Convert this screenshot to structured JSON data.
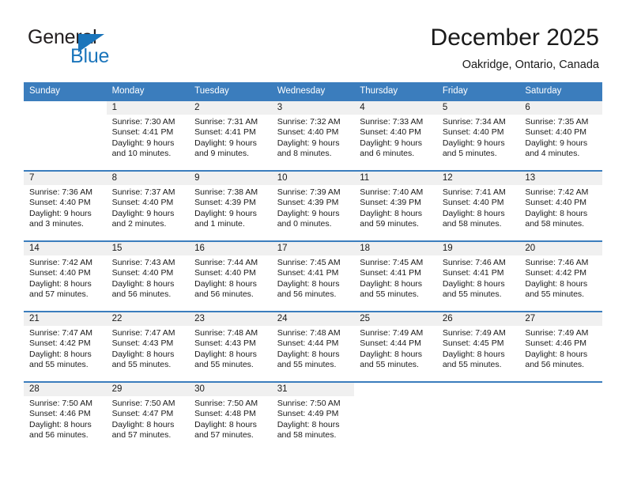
{
  "brand": {
    "name_top": "General",
    "name_bottom": "Blue",
    "color_primary": "#1b75bb",
    "color_text": "#231f20"
  },
  "header": {
    "month_title": "December 2025",
    "location": "Oakridge, Ontario, Canada",
    "header_bg": "#3b7dbd",
    "daynum_bg": "#f0f0f0"
  },
  "calendar": {
    "weekday_headers": [
      "Sunday",
      "Monday",
      "Tuesday",
      "Wednesday",
      "Thursday",
      "Friday",
      "Saturday"
    ],
    "weeks": [
      [
        {
          "empty": true
        },
        {
          "day": "1",
          "sunrise": "Sunrise: 7:30 AM",
          "sunset": "Sunset: 4:41 PM",
          "daylight": "Daylight: 9 hours and 10 minutes."
        },
        {
          "day": "2",
          "sunrise": "Sunrise: 7:31 AM",
          "sunset": "Sunset: 4:41 PM",
          "daylight": "Daylight: 9 hours and 9 minutes."
        },
        {
          "day": "3",
          "sunrise": "Sunrise: 7:32 AM",
          "sunset": "Sunset: 4:40 PM",
          "daylight": "Daylight: 9 hours and 8 minutes."
        },
        {
          "day": "4",
          "sunrise": "Sunrise: 7:33 AM",
          "sunset": "Sunset: 4:40 PM",
          "daylight": "Daylight: 9 hours and 6 minutes."
        },
        {
          "day": "5",
          "sunrise": "Sunrise: 7:34 AM",
          "sunset": "Sunset: 4:40 PM",
          "daylight": "Daylight: 9 hours and 5 minutes."
        },
        {
          "day": "6",
          "sunrise": "Sunrise: 7:35 AM",
          "sunset": "Sunset: 4:40 PM",
          "daylight": "Daylight: 9 hours and 4 minutes."
        }
      ],
      [
        {
          "day": "7",
          "sunrise": "Sunrise: 7:36 AM",
          "sunset": "Sunset: 4:40 PM",
          "daylight": "Daylight: 9 hours and 3 minutes."
        },
        {
          "day": "8",
          "sunrise": "Sunrise: 7:37 AM",
          "sunset": "Sunset: 4:40 PM",
          "daylight": "Daylight: 9 hours and 2 minutes."
        },
        {
          "day": "9",
          "sunrise": "Sunrise: 7:38 AM",
          "sunset": "Sunset: 4:39 PM",
          "daylight": "Daylight: 9 hours and 1 minute."
        },
        {
          "day": "10",
          "sunrise": "Sunrise: 7:39 AM",
          "sunset": "Sunset: 4:39 PM",
          "daylight": "Daylight: 9 hours and 0 minutes."
        },
        {
          "day": "11",
          "sunrise": "Sunrise: 7:40 AM",
          "sunset": "Sunset: 4:39 PM",
          "daylight": "Daylight: 8 hours and 59 minutes."
        },
        {
          "day": "12",
          "sunrise": "Sunrise: 7:41 AM",
          "sunset": "Sunset: 4:40 PM",
          "daylight": "Daylight: 8 hours and 58 minutes."
        },
        {
          "day": "13",
          "sunrise": "Sunrise: 7:42 AM",
          "sunset": "Sunset: 4:40 PM",
          "daylight": "Daylight: 8 hours and 58 minutes."
        }
      ],
      [
        {
          "day": "14",
          "sunrise": "Sunrise: 7:42 AM",
          "sunset": "Sunset: 4:40 PM",
          "daylight": "Daylight: 8 hours and 57 minutes."
        },
        {
          "day": "15",
          "sunrise": "Sunrise: 7:43 AM",
          "sunset": "Sunset: 4:40 PM",
          "daylight": "Daylight: 8 hours and 56 minutes."
        },
        {
          "day": "16",
          "sunrise": "Sunrise: 7:44 AM",
          "sunset": "Sunset: 4:40 PM",
          "daylight": "Daylight: 8 hours and 56 minutes."
        },
        {
          "day": "17",
          "sunrise": "Sunrise: 7:45 AM",
          "sunset": "Sunset: 4:41 PM",
          "daylight": "Daylight: 8 hours and 56 minutes."
        },
        {
          "day": "18",
          "sunrise": "Sunrise: 7:45 AM",
          "sunset": "Sunset: 4:41 PM",
          "daylight": "Daylight: 8 hours and 55 minutes."
        },
        {
          "day": "19",
          "sunrise": "Sunrise: 7:46 AM",
          "sunset": "Sunset: 4:41 PM",
          "daylight": "Daylight: 8 hours and 55 minutes."
        },
        {
          "day": "20",
          "sunrise": "Sunrise: 7:46 AM",
          "sunset": "Sunset: 4:42 PM",
          "daylight": "Daylight: 8 hours and 55 minutes."
        }
      ],
      [
        {
          "day": "21",
          "sunrise": "Sunrise: 7:47 AM",
          "sunset": "Sunset: 4:42 PM",
          "daylight": "Daylight: 8 hours and 55 minutes."
        },
        {
          "day": "22",
          "sunrise": "Sunrise: 7:47 AM",
          "sunset": "Sunset: 4:43 PM",
          "daylight": "Daylight: 8 hours and 55 minutes."
        },
        {
          "day": "23",
          "sunrise": "Sunrise: 7:48 AM",
          "sunset": "Sunset: 4:43 PM",
          "daylight": "Daylight: 8 hours and 55 minutes."
        },
        {
          "day": "24",
          "sunrise": "Sunrise: 7:48 AM",
          "sunset": "Sunset: 4:44 PM",
          "daylight": "Daylight: 8 hours and 55 minutes."
        },
        {
          "day": "25",
          "sunrise": "Sunrise: 7:49 AM",
          "sunset": "Sunset: 4:44 PM",
          "daylight": "Daylight: 8 hours and 55 minutes."
        },
        {
          "day": "26",
          "sunrise": "Sunrise: 7:49 AM",
          "sunset": "Sunset: 4:45 PM",
          "daylight": "Daylight: 8 hours and 55 minutes."
        },
        {
          "day": "27",
          "sunrise": "Sunrise: 7:49 AM",
          "sunset": "Sunset: 4:46 PM",
          "daylight": "Daylight: 8 hours and 56 minutes."
        }
      ],
      [
        {
          "day": "28",
          "sunrise": "Sunrise: 7:50 AM",
          "sunset": "Sunset: 4:46 PM",
          "daylight": "Daylight: 8 hours and 56 minutes."
        },
        {
          "day": "29",
          "sunrise": "Sunrise: 7:50 AM",
          "sunset": "Sunset: 4:47 PM",
          "daylight": "Daylight: 8 hours and 57 minutes."
        },
        {
          "day": "30",
          "sunrise": "Sunrise: 7:50 AM",
          "sunset": "Sunset: 4:48 PM",
          "daylight": "Daylight: 8 hours and 57 minutes."
        },
        {
          "day": "31",
          "sunrise": "Sunrise: 7:50 AM",
          "sunset": "Sunset: 4:49 PM",
          "daylight": "Daylight: 8 hours and 58 minutes."
        },
        {
          "empty": true
        },
        {
          "empty": true
        },
        {
          "empty": true
        }
      ]
    ]
  }
}
